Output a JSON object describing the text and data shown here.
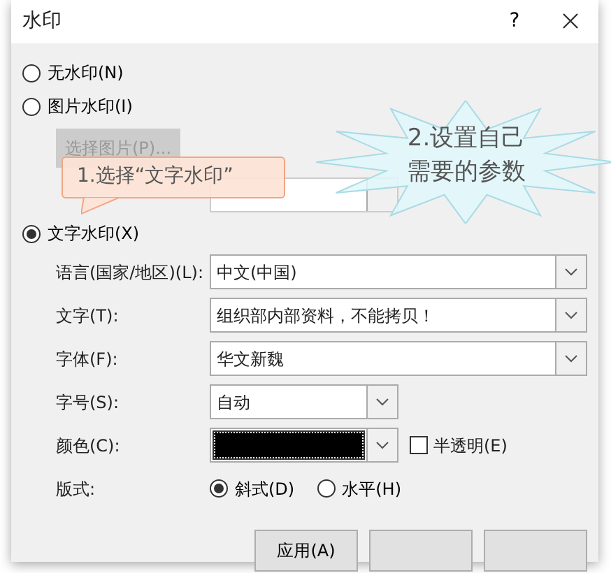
{
  "window": {
    "title": "水印",
    "help": "?"
  },
  "options": [
    {
      "kind": "none",
      "label": "无水印(N)",
      "selected": false
    },
    {
      "kind": "picture",
      "label": "图片水印(I)",
      "selected": false,
      "button": "选择图片(P)...",
      "disabled": true
    },
    {
      "kind": "text",
      "label": "文字水印(X)",
      "selected": true
    }
  ],
  "text_fields": [
    {
      "label": "语言(国家/地区)(L):",
      "value": "中文(中国)",
      "wide": true
    },
    {
      "label": "文字(T):",
      "value": "组织部内部资料，不能拷贝！",
      "wide": true
    },
    {
      "label": "字体(F):",
      "value": "华文新魏",
      "wide": true
    },
    {
      "label": "字号(S):",
      "value": "自动",
      "wide": false
    }
  ],
  "color": {
    "label": "颜色(C):",
    "color": "#000000",
    "semitransparent_label": "半透明(E)",
    "semitransparent_checked": false
  },
  "layout": {
    "label": "版式:",
    "choices": [
      {
        "label": "斜式(D)",
        "selected": true
      },
      {
        "label": "水平(H)",
        "selected": false
      }
    ]
  },
  "buttons": [
    {
      "kind": "labelled",
      "label": "应用(A)"
    },
    {
      "kind": "covered"
    },
    {
      "kind": "covered"
    }
  ],
  "callouts": [
    {
      "kind": "rectangle",
      "text": "1.选择“文字水印”"
    },
    {
      "kind": "burst",
      "text": "2.设置自己需要的参数"
    }
  ]
}
